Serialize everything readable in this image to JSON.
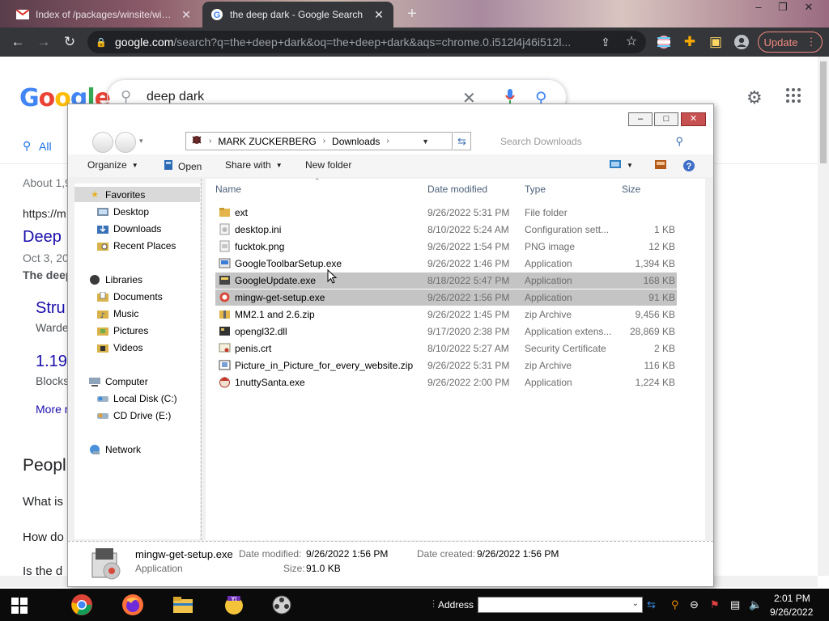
{
  "browser": {
    "tabs": [
      {
        "title": "Index of /packages/winsite/win..."
      },
      {
        "title": "the deep dark - Google Search"
      }
    ],
    "new_tab": "+",
    "window_controls": [
      "–",
      "❐",
      "✕"
    ],
    "url_host": "google.com",
    "url_rest": "/search?q=the+deep+dark&oq=the+deep+dark&aqs=chrome.0.i512l4j46i512l...",
    "update_label": "Update"
  },
  "google": {
    "query": "deep dark",
    "tab_all": "All",
    "result_count": "About 1,9",
    "url_line": "https://m",
    "result_title": "Deep I",
    "date_line": "Oct 3, 20",
    "snippet_bold": "The deep",
    "strip_title": "Stru",
    "strip_sub": "Warde",
    "num_title": "1.19",
    "num_sub": "Blocks",
    "more": "More r",
    "people_heading": "Peopl",
    "question_1": "What is",
    "question_2": "How do",
    "question_3": "Is the d"
  },
  "explorer": {
    "window_buttons": [
      "–",
      "□",
      "✕"
    ],
    "breadcrumb": [
      "MARK ZUCKERBERG",
      "Downloads"
    ],
    "search_placeholder": "Search Downloads",
    "commands": {
      "organize": "Organize",
      "open": "Open",
      "share_with": "Share with",
      "new_folder": "New folder"
    },
    "nav": {
      "favorites": "Favorites",
      "desktop": "Desktop",
      "downloads": "Downloads",
      "recent": "Recent Places",
      "libraries": "Libraries",
      "documents": "Documents",
      "music": "Music",
      "pictures": "Pictures",
      "videos": "Videos",
      "computer": "Computer",
      "local_disk": "Local Disk (C:)",
      "cd_drive": "CD Drive (E:)",
      "network": "Network"
    },
    "columns": {
      "name": "Name",
      "date": "Date modified",
      "type": "Type",
      "size": "Size"
    },
    "files": [
      {
        "name": "ext",
        "date": "9/26/2022 5:31 PM",
        "type": "File folder",
        "size": ""
      },
      {
        "name": "desktop.ini",
        "date": "8/10/2022 5:24 AM",
        "type": "Configuration sett...",
        "size": "1 KB"
      },
      {
        "name": "fucktok.png",
        "date": "9/26/2022 1:54 PM",
        "type": "PNG image",
        "size": "12 KB"
      },
      {
        "name": "GoogleToolbarSetup.exe",
        "date": "9/26/2022 1:46 PM",
        "type": "Application",
        "size": "1,394 KB"
      },
      {
        "name": "GoogleUpdate.exe",
        "date": "8/18/2022 5:47 PM",
        "type": "Application",
        "size": "168 KB"
      },
      {
        "name": "mingw-get-setup.exe",
        "date": "9/26/2022 1:56 PM",
        "type": "Application",
        "size": "91 KB"
      },
      {
        "name": "MM2.1 and 2.6.zip",
        "date": "9/26/2022 1:45 PM",
        "type": "zip Archive",
        "size": "9,456 KB"
      },
      {
        "name": "opengl32.dll",
        "date": "9/17/2020 2:38 PM",
        "type": "Application extens...",
        "size": "28,869 KB"
      },
      {
        "name": "penis.crt",
        "date": "8/10/2022 5:27 AM",
        "type": "Security Certificate",
        "size": "2 KB"
      },
      {
        "name": "Picture_in_Picture_for_every_website.zip",
        "date": "9/26/2022 5:31 PM",
        "type": "zip Archive",
        "size": "116 KB"
      },
      {
        "name": "1nuttySanta.exe",
        "date": "9/26/2022 2:00 PM",
        "type": "Application",
        "size": "1,224 KB"
      }
    ],
    "details": {
      "filename": "mingw-get-setup.exe",
      "kind": "Application",
      "date_modified_label": "Date modified:",
      "date_modified": "9/26/2022 1:56 PM",
      "date_created_label": "Date created:",
      "date_created": "9/26/2022 1:56 PM",
      "size_label": "Size:",
      "size": "91.0 KB"
    }
  },
  "taskbar": {
    "address_label": "Address",
    "time": "2:01 PM",
    "date": "9/26/2022"
  },
  "colors": {
    "chrome_toolbar": "#35363a",
    "update_accent": "#f28b82",
    "google_blue": "#4285f4",
    "link_blue": "#1a0dab",
    "selection": "#c4c4c4"
  },
  "icons": [
    "back-icon",
    "forward-icon",
    "reload-icon",
    "lock-icon",
    "share-icon",
    "star-icon",
    "extensions-icon",
    "sidepanel-icon",
    "profile-icon",
    "kebab-icon",
    "search-icon",
    "mic-icon",
    "close-icon",
    "gear-icon",
    "apps-icon",
    "windows-start-icon",
    "chrome-icon",
    "firefox-icon",
    "file-explorer-icon",
    "yahoo-icon",
    "film-icon"
  ]
}
